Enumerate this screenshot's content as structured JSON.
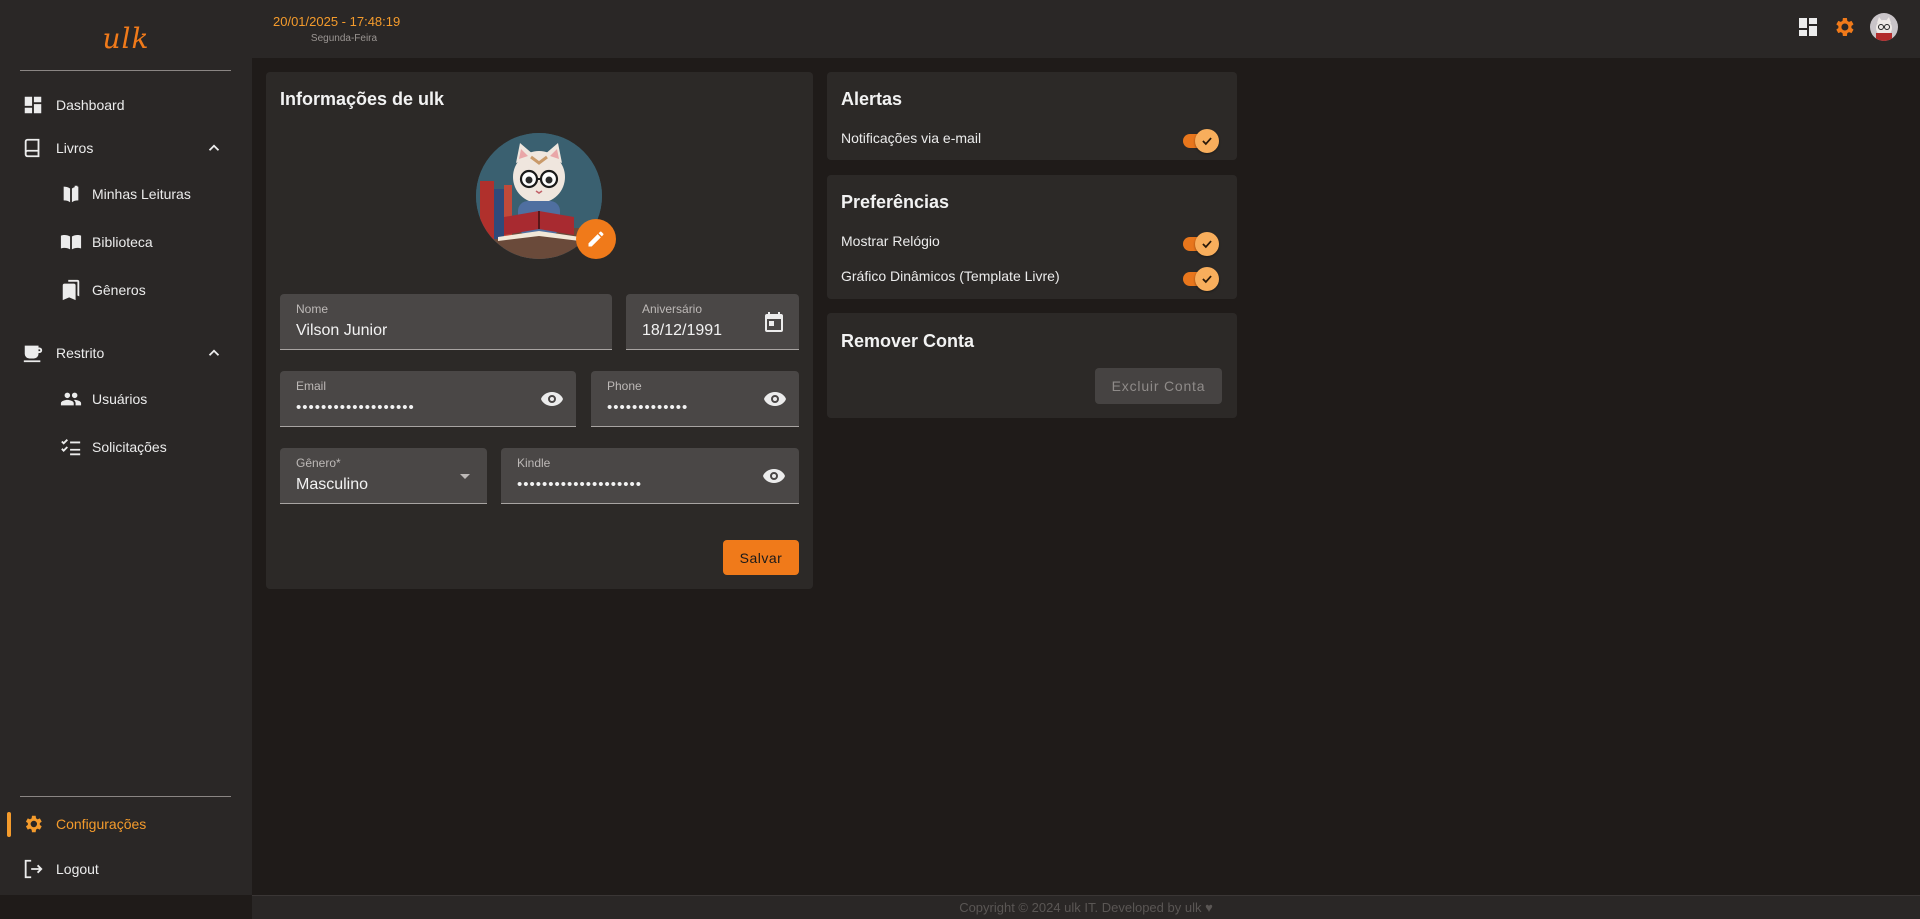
{
  "app": {
    "logo": "ulk",
    "accent_color": "#f07a1a"
  },
  "header": {
    "datetime": "20/01/2025 - 17:48:19",
    "weekday": "Segunda-Feira",
    "icons": [
      "dashboard-icon",
      "gear-icon",
      "avatar"
    ]
  },
  "sidebar": {
    "items": [
      {
        "label": "Dashboard",
        "icon": "dashboard-icon"
      },
      {
        "label": "Livros",
        "icon": "book-icon"
      },
      {
        "label": "Minhas Leituras",
        "icon": "open-book-icon"
      },
      {
        "label": "Biblioteca",
        "icon": "library-icon"
      },
      {
        "label": "Gêneros",
        "icon": "bookmarks-icon"
      },
      {
        "label": "Restrito",
        "icon": "coffee-icon"
      },
      {
        "label": "Usuários",
        "icon": "people-icon"
      },
      {
        "label": "Solicitações",
        "icon": "checklist-icon"
      }
    ],
    "bottom": [
      {
        "label": "Configurações",
        "icon": "gear-icon"
      },
      {
        "label": "Logout",
        "icon": "logout-icon"
      }
    ]
  },
  "profile": {
    "title": "Informações de ulk",
    "fields": {
      "name": {
        "label": "Nome",
        "value": "Vilson Junior"
      },
      "birthday": {
        "label": "Aniversário",
        "value": "18/12/1991"
      },
      "email": {
        "label": "Email",
        "value": "•••••••••••••••••••"
      },
      "phone": {
        "label": "Phone",
        "value": "•••••••••••••"
      },
      "gender": {
        "label": "Gênero*",
        "value": "Masculino"
      },
      "kindle": {
        "label": "Kindle",
        "value": "••••••••••••••••••••"
      }
    },
    "save_label": "Salvar"
  },
  "alerts": {
    "title": "Alertas",
    "options": [
      {
        "label": "Notificações via e-mail",
        "enabled": true
      }
    ]
  },
  "preferences": {
    "title": "Preferências",
    "options": [
      {
        "label": "Mostrar Relógio",
        "enabled": true
      },
      {
        "label": "Gráfico Dinâmicos (Template Livre)",
        "enabled": true
      }
    ]
  },
  "remove_account": {
    "title": "Remover Conta",
    "button_label": "Excluir Conta"
  },
  "footer": {
    "text": "Copyright © 2024 ulk IT. Developed by ulk ♥"
  }
}
